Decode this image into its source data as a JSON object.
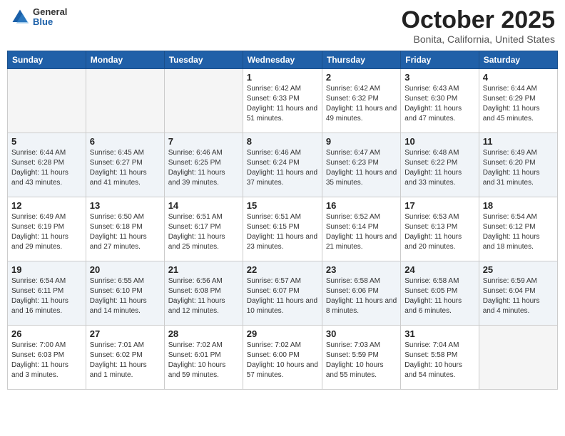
{
  "header": {
    "logo_general": "General",
    "logo_blue": "Blue",
    "month_title": "October 2025",
    "location": "Bonita, California, United States"
  },
  "weekdays": [
    "Sunday",
    "Monday",
    "Tuesday",
    "Wednesday",
    "Thursday",
    "Friday",
    "Saturday"
  ],
  "weeks": [
    [
      {
        "day": "",
        "empty": true
      },
      {
        "day": "",
        "empty": true
      },
      {
        "day": "",
        "empty": true
      },
      {
        "day": "1",
        "sunrise": "6:42 AM",
        "sunset": "6:33 PM",
        "daylight": "11 hours and 51 minutes."
      },
      {
        "day": "2",
        "sunrise": "6:42 AM",
        "sunset": "6:32 PM",
        "daylight": "11 hours and 49 minutes."
      },
      {
        "day": "3",
        "sunrise": "6:43 AM",
        "sunset": "6:30 PM",
        "daylight": "11 hours and 47 minutes."
      },
      {
        "day": "4",
        "sunrise": "6:44 AM",
        "sunset": "6:29 PM",
        "daylight": "11 hours and 45 minutes."
      }
    ],
    [
      {
        "day": "5",
        "sunrise": "6:44 AM",
        "sunset": "6:28 PM",
        "daylight": "11 hours and 43 minutes."
      },
      {
        "day": "6",
        "sunrise": "6:45 AM",
        "sunset": "6:27 PM",
        "daylight": "11 hours and 41 minutes."
      },
      {
        "day": "7",
        "sunrise": "6:46 AM",
        "sunset": "6:25 PM",
        "daylight": "11 hours and 39 minutes."
      },
      {
        "day": "8",
        "sunrise": "6:46 AM",
        "sunset": "6:24 PM",
        "daylight": "11 hours and 37 minutes."
      },
      {
        "day": "9",
        "sunrise": "6:47 AM",
        "sunset": "6:23 PM",
        "daylight": "11 hours and 35 minutes."
      },
      {
        "day": "10",
        "sunrise": "6:48 AM",
        "sunset": "6:22 PM",
        "daylight": "11 hours and 33 minutes."
      },
      {
        "day": "11",
        "sunrise": "6:49 AM",
        "sunset": "6:20 PM",
        "daylight": "11 hours and 31 minutes."
      }
    ],
    [
      {
        "day": "12",
        "sunrise": "6:49 AM",
        "sunset": "6:19 PM",
        "daylight": "11 hours and 29 minutes."
      },
      {
        "day": "13",
        "sunrise": "6:50 AM",
        "sunset": "6:18 PM",
        "daylight": "11 hours and 27 minutes."
      },
      {
        "day": "14",
        "sunrise": "6:51 AM",
        "sunset": "6:17 PM",
        "daylight": "11 hours and 25 minutes."
      },
      {
        "day": "15",
        "sunrise": "6:51 AM",
        "sunset": "6:15 PM",
        "daylight": "11 hours and 23 minutes."
      },
      {
        "day": "16",
        "sunrise": "6:52 AM",
        "sunset": "6:14 PM",
        "daylight": "11 hours and 21 minutes."
      },
      {
        "day": "17",
        "sunrise": "6:53 AM",
        "sunset": "6:13 PM",
        "daylight": "11 hours and 20 minutes."
      },
      {
        "day": "18",
        "sunrise": "6:54 AM",
        "sunset": "6:12 PM",
        "daylight": "11 hours and 18 minutes."
      }
    ],
    [
      {
        "day": "19",
        "sunrise": "6:54 AM",
        "sunset": "6:11 PM",
        "daylight": "11 hours and 16 minutes."
      },
      {
        "day": "20",
        "sunrise": "6:55 AM",
        "sunset": "6:10 PM",
        "daylight": "11 hours and 14 minutes."
      },
      {
        "day": "21",
        "sunrise": "6:56 AM",
        "sunset": "6:08 PM",
        "daylight": "11 hours and 12 minutes."
      },
      {
        "day": "22",
        "sunrise": "6:57 AM",
        "sunset": "6:07 PM",
        "daylight": "11 hours and 10 minutes."
      },
      {
        "day": "23",
        "sunrise": "6:58 AM",
        "sunset": "6:06 PM",
        "daylight": "11 hours and 8 minutes."
      },
      {
        "day": "24",
        "sunrise": "6:58 AM",
        "sunset": "6:05 PM",
        "daylight": "11 hours and 6 minutes."
      },
      {
        "day": "25",
        "sunrise": "6:59 AM",
        "sunset": "6:04 PM",
        "daylight": "11 hours and 4 minutes."
      }
    ],
    [
      {
        "day": "26",
        "sunrise": "7:00 AM",
        "sunset": "6:03 PM",
        "daylight": "11 hours and 3 minutes."
      },
      {
        "day": "27",
        "sunrise": "7:01 AM",
        "sunset": "6:02 PM",
        "daylight": "11 hours and 1 minute."
      },
      {
        "day": "28",
        "sunrise": "7:02 AM",
        "sunset": "6:01 PM",
        "daylight": "10 hours and 59 minutes."
      },
      {
        "day": "29",
        "sunrise": "7:02 AM",
        "sunset": "6:00 PM",
        "daylight": "10 hours and 57 minutes."
      },
      {
        "day": "30",
        "sunrise": "7:03 AM",
        "sunset": "5:59 PM",
        "daylight": "10 hours and 55 minutes."
      },
      {
        "day": "31",
        "sunrise": "7:04 AM",
        "sunset": "5:58 PM",
        "daylight": "10 hours and 54 minutes."
      },
      {
        "day": "",
        "empty": true
      }
    ]
  ]
}
